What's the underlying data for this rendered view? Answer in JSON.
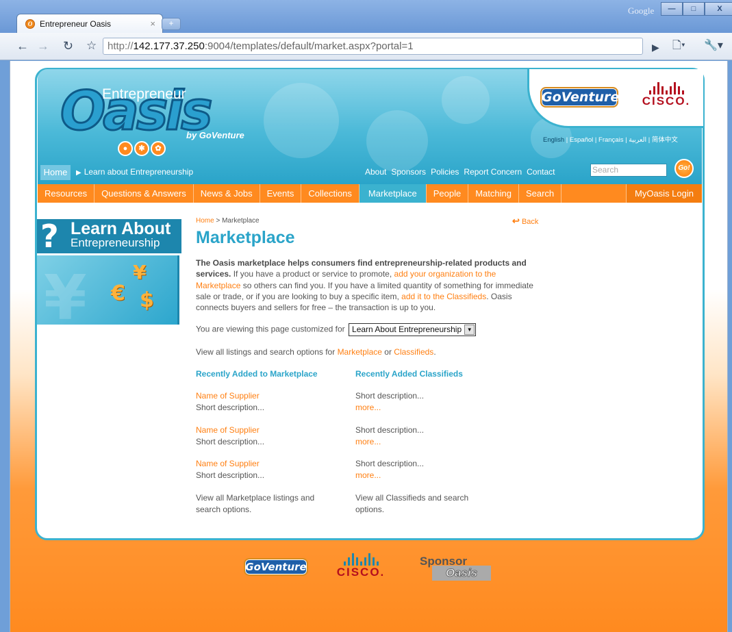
{
  "browser": {
    "tab_title": "Entrepreneur Oasis",
    "tab_close": "×",
    "new_tab": "+",
    "google_label": "Google",
    "url_prefix": "http://",
    "url_host": "142.177.37.250",
    "url_rest": ":9004/templates/default/market.aspx?portal=1",
    "win_min": "—",
    "win_max": "□",
    "win_close": "X"
  },
  "header": {
    "logo_word1": "Entrepreneur",
    "logo_word2": "Oasis",
    "logo_by": "by GoVenture",
    "goventure_label": "GoVenture",
    "cisco_label": "CISCO.",
    "languages": {
      "english": "English",
      "espanol": "Español",
      "francais": "Français",
      "arabic": "العربية",
      "chinese": "简体中文",
      "sep": " | "
    },
    "home": "Home",
    "learn_link": "Learn about Entrepreneurship",
    "util_links": [
      "About",
      "Sponsors",
      "Policies",
      "Report Concern",
      "Contact"
    ],
    "search_placeholder": "Search",
    "go_label": "Go!"
  },
  "nav": {
    "items": [
      "Resources",
      "Questions & Answers",
      "News & Jobs",
      "Events",
      "Collections",
      "Marketplace",
      "People",
      "Matching",
      "Search"
    ],
    "active": "Marketplace",
    "login": "MyOasis Login"
  },
  "left_panel": {
    "question_mark": "?",
    "title": "Learn About",
    "subtitle": "Entrepreneurship",
    "symbols": [
      "¥",
      "€",
      "$"
    ]
  },
  "main": {
    "breadcrumb_home": "Home",
    "breadcrumb_sep": " > ",
    "breadcrumb_current": "Marketplace",
    "back": "Back",
    "title": "Marketplace",
    "intro_bold": "The Oasis marketplace helps consumers find entrepreneurship-related products and services.",
    "intro_1": " If you have a product or service to promote, ",
    "intro_link1": "add your organization to the Marketplace",
    "intro_2": " so others can find you. If you have a limited quantity of something for immediate sale or trade, or if you are looking to buy a specific item, ",
    "intro_link2": "add it to the Classifieds",
    "intro_3": ". Oasis connects buyers and sellers for free – the transaction is up to you.",
    "customized_label": "You are viewing this page customized for",
    "customized_value": "Learn About Entrepreneurship",
    "view_all_prefix": "View all listings and search options for ",
    "view_all_link1": "Marketplace",
    "view_all_or": " or ",
    "view_all_link2": "Classifieds",
    "view_all_end": ".",
    "col1_heading": "Recently Added to Marketplace",
    "col2_heading": "Recently Added Classifieds",
    "marketplace_items": [
      {
        "name": "Name of Supplier",
        "desc": "Short description..."
      },
      {
        "name": "Name of Supplier",
        "desc": "Short description..."
      },
      {
        "name": "Name of Supplier",
        "desc": "Short description..."
      }
    ],
    "classified_items": [
      {
        "desc": "Short description...",
        "more": "more..."
      },
      {
        "desc": "Short description...",
        "more": "more..."
      },
      {
        "desc": "Short description...",
        "more": "more..."
      }
    ],
    "col1_view_all": "View all Marketplace listings and search options.",
    "col2_view_all": "View all Classifieds and search options."
  },
  "footer": {
    "goventure_label": "GoVenture",
    "cisco_label": "CISCO.",
    "sponsor_top": "Sponsor",
    "sponsor_bottom": "Oasis"
  },
  "colors": {
    "teal": "#2aa4c9",
    "orange": "#ff8a1f",
    "link": "#ff7f11"
  }
}
